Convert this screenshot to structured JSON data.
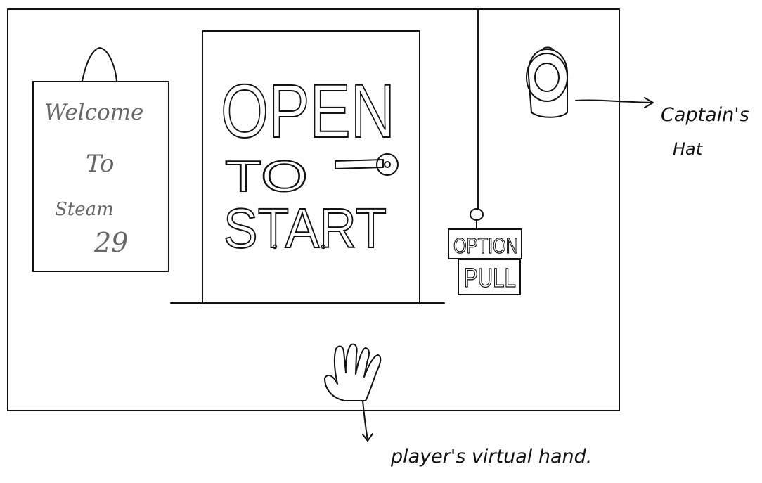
{
  "welcome_sign": {
    "line1": "Welcome",
    "line2": "To",
    "line3": "Steam",
    "line4": "29"
  },
  "door": {
    "line1": "OPEN",
    "line2": "TO",
    "line3": "START"
  },
  "pull_sign": {
    "line1": "OPTION",
    "line2": "PULL"
  },
  "annotations": {
    "hat_line1": "Captain's",
    "hat_line2": "Hat",
    "hand": "player's virtual hand."
  }
}
